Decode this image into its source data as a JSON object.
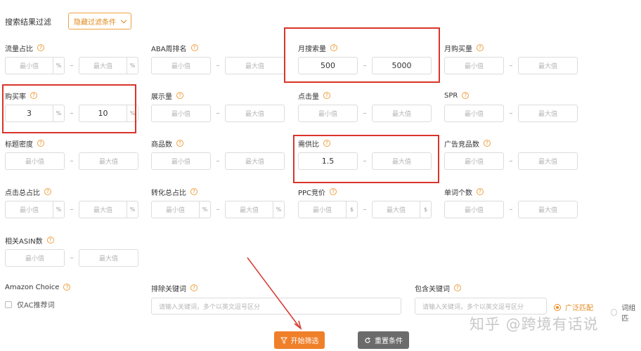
{
  "header": {
    "title": "搜索结果过滤",
    "toggle_label": "隐藏过滤条件"
  },
  "placeholders": {
    "min": "最小值",
    "max": "最大值",
    "keyword": "请输入关键词，多个以英文逗号区分"
  },
  "fields": {
    "flow_ratio": {
      "label": "流量占比",
      "unit": "%"
    },
    "aba_rank": {
      "label": "ABA周排名"
    },
    "search_volume": {
      "label": "月搜索量",
      "min": "500",
      "max": "5000"
    },
    "purchase_volume": {
      "label": "月购买量"
    },
    "purchase_rate": {
      "label": "购买率",
      "unit": "%",
      "min": "3",
      "max": "10"
    },
    "impressions": {
      "label": "展示量"
    },
    "clicks": {
      "label": "点击量"
    },
    "spr": {
      "label": "SPR"
    },
    "title_density": {
      "label": "标题密度"
    },
    "product_count": {
      "label": "商品数"
    },
    "supply_demand": {
      "label": "需供比",
      "min": "1.5"
    },
    "ad_competitors": {
      "label": "广告竞品数"
    },
    "click_share": {
      "label": "点击总占比",
      "unit": "%"
    },
    "conversion_share": {
      "label": "转化总占比",
      "unit": "%"
    },
    "ppc_bid": {
      "label": "PPC竞价",
      "unit": "$"
    },
    "word_count": {
      "label": "单词个数"
    },
    "asin_count": {
      "label": "相关ASIN数"
    }
  },
  "amazon_choice": {
    "label": "Amazon Choice",
    "checkbox": "仅AC推荐词"
  },
  "exclude": {
    "label": "排除关键词"
  },
  "include": {
    "label": "包含关键词",
    "radio_broad": "广泛匹配",
    "radio_phrase": "词组匹"
  },
  "buttons": {
    "start": "开始筛选",
    "reset": "重置条件"
  },
  "watermark": "知乎 @跨境有话说",
  "colors": {
    "accent": "#f07f2a",
    "highlight": "#d9342b"
  }
}
